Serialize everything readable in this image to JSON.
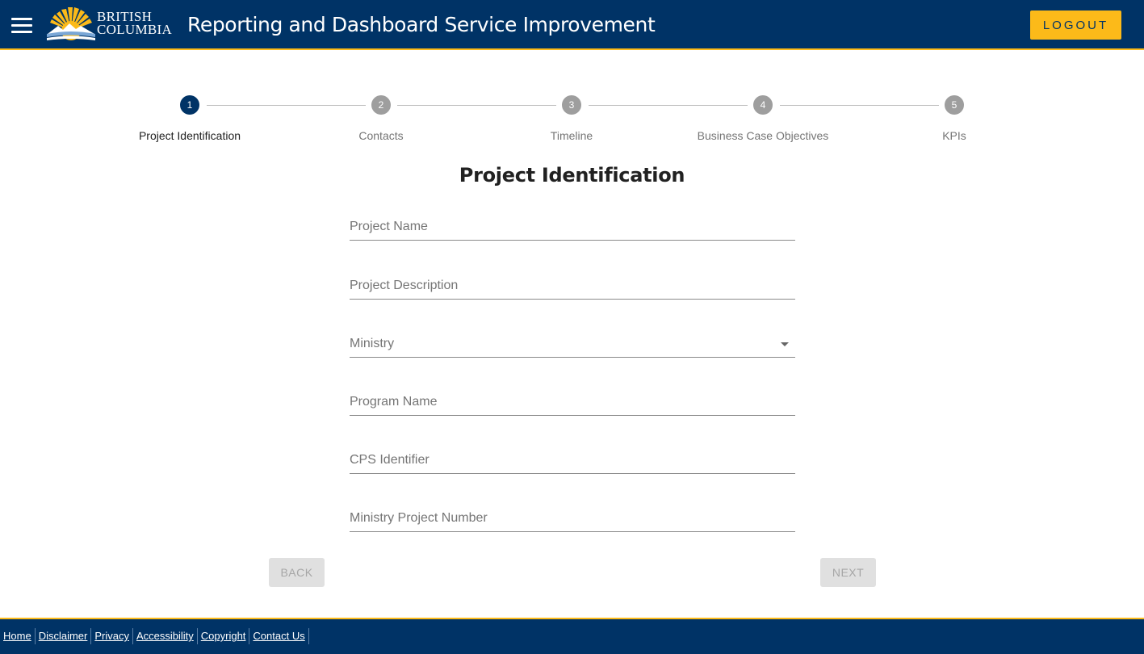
{
  "header": {
    "logo_line1": "BRITISH",
    "logo_line2": "COLUMBIA",
    "title": "Reporting and Dashboard Service Improvement",
    "logout_label": "LOGOUT"
  },
  "stepper": {
    "steps": [
      {
        "number": "1",
        "label": "Project Identification",
        "active": true
      },
      {
        "number": "2",
        "label": "Contacts",
        "active": false
      },
      {
        "number": "3",
        "label": "Timeline",
        "active": false
      },
      {
        "number": "4",
        "label": "Business Case Objectives",
        "active": false
      },
      {
        "number": "5",
        "label": "KPIs",
        "active": false
      }
    ]
  },
  "form": {
    "title": "Project Identification",
    "fields": {
      "project_name": {
        "placeholder": "Project Name",
        "value": ""
      },
      "project_description": {
        "placeholder": "Project Description",
        "value": ""
      },
      "ministry": {
        "placeholder": "Ministry",
        "value": ""
      },
      "program_name": {
        "placeholder": "Program Name",
        "value": ""
      },
      "cps_identifier": {
        "placeholder": "CPS Identifier",
        "value": ""
      },
      "ministry_project_number": {
        "placeholder": "Ministry Project Number",
        "value": ""
      }
    },
    "back_label": "BACK",
    "next_label": "NEXT"
  },
  "footer": {
    "links": [
      "Home",
      "Disclaimer",
      "Privacy",
      "Accessibility",
      "Copyright",
      "Contact Us"
    ]
  },
  "colors": {
    "primary": "#003366",
    "accent": "#fcba19",
    "step_inactive": "#9e9e9e"
  },
  "icons": {
    "menu": "hamburger-menu-icon",
    "logo": "bc-sun-logo-icon",
    "dropdown": "dropdown-arrow-icon"
  }
}
